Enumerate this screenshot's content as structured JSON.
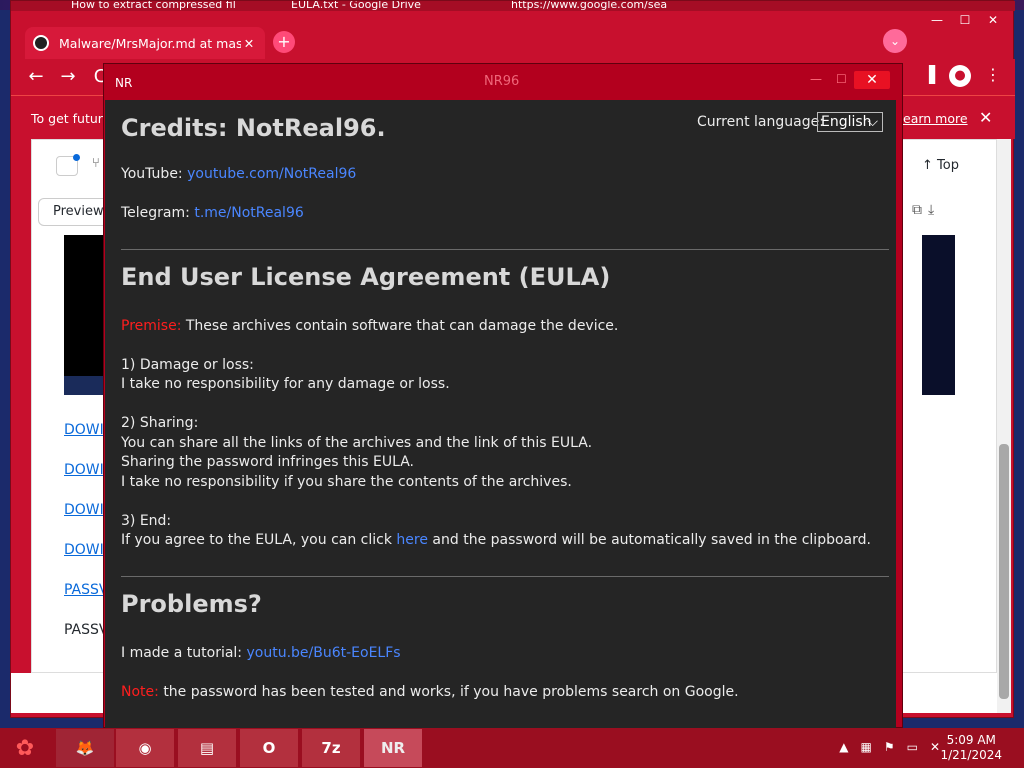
{
  "desktop": {
    "top_tabs": [
      {
        "label": "How to extract compressed fil"
      },
      {
        "label": "EULA.txt - Google Drive"
      },
      {
        "label": "https://www.google.com/sea"
      }
    ]
  },
  "browser": {
    "active_tab": {
      "title": "Malware/MrsMajor.md at master",
      "close": "✕"
    },
    "new_tab": "+",
    "window_controls": {
      "minimize": "—",
      "maximize": "☐",
      "close": "✕"
    },
    "infobar": {
      "text": "To get future",
      "learn_more": "earn more",
      "close": "✕"
    }
  },
  "github_page": {
    "preview_label": "Preview",
    "top_label": "Top",
    "links": [
      "DOWI",
      "DOWI",
      "DOWI",
      "DOWI",
      "PASSV"
    ],
    "plain": "PASSV"
  },
  "nr_window": {
    "label": "NR",
    "title": "NR96",
    "close": "✕",
    "credits_title": "Credits: NotReal96.",
    "language_label": "Current language:",
    "language_value": "English",
    "youtube_label": "YouTube:",
    "youtube_link": "youtube.com/NotReal96",
    "telegram_label": "Telegram:",
    "telegram_link": "t.me/NotReal96",
    "eula_title": "End User License Agreement (EULA)",
    "premise_label": "Premise:",
    "premise_text": "These archives contain software that can damage the device.",
    "s1_title": "1) Damage or loss:",
    "s1_l1": "I take no responsibility for any damage or loss.",
    "s2_title": "2) Sharing:",
    "s2_l1": "You can share all the links of the archives and the link of this EULA.",
    "s2_l2": "Sharing the password infringes this EULA.",
    "s2_l3": "I take no responsibility if you share the contents of the archives.",
    "s3_title": "3) End:",
    "s3_pre": "If you agree to the EULA, you can click",
    "s3_link": "here",
    "s3_post": "and the password will be automatically saved in the clipboard.",
    "problems_title": "Problems?",
    "tutorial_label": "I made a tutorial:",
    "tutorial_link": "youtu.be/Bu6t-EoELFs",
    "note_label": "Note:",
    "note_text": "the password has been tested and works, if you have problems search on Google."
  },
  "taskbar": {
    "apps": [
      {
        "name": "Firefox",
        "glyph": "🦊"
      },
      {
        "name": "Chrome",
        "glyph": "◉"
      },
      {
        "name": "Files",
        "glyph": "▤"
      },
      {
        "name": "Outlook",
        "glyph": "O"
      },
      {
        "name": "7-Zip",
        "glyph": "7z"
      },
      {
        "name": "NR",
        "glyph": "NR"
      }
    ],
    "time": "5:09 AM",
    "date": "1/21/2024"
  }
}
